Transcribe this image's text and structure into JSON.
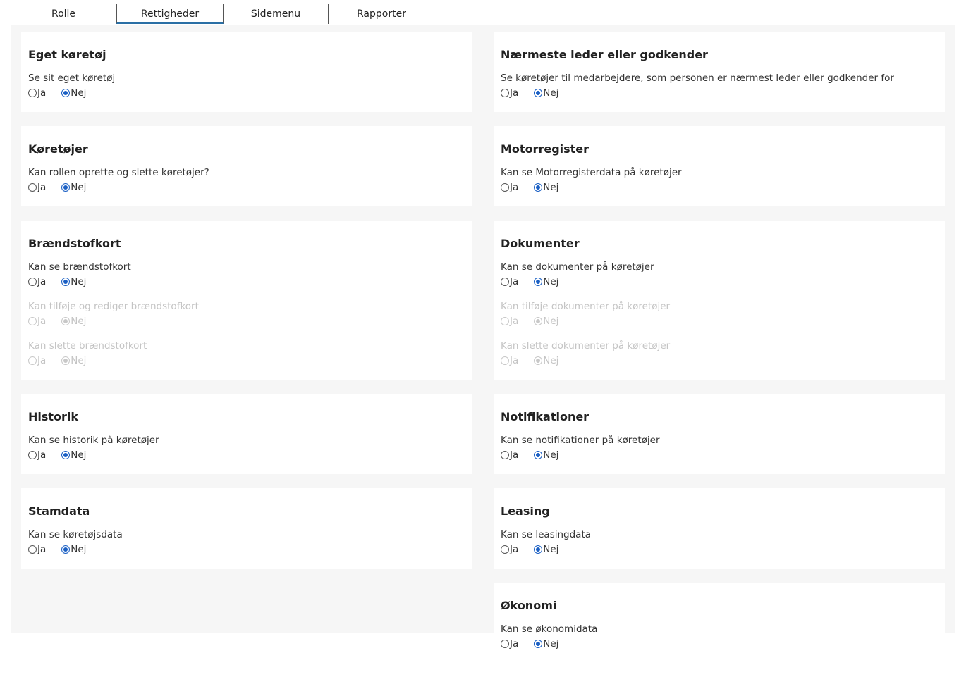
{
  "tabs": [
    {
      "label": "Rolle"
    },
    {
      "label": "Rettigheder"
    },
    {
      "label": "Sidemenu"
    },
    {
      "label": "Rapporter"
    }
  ],
  "accent_color": "#2a6fa5",
  "radio_labels": {
    "yes": "Ja",
    "no": "Nej"
  },
  "left_sections": [
    {
      "title": "Eget køretøj",
      "questions": [
        {
          "text": "Se sit eget køretøj",
          "value": "Nej",
          "disabled": false
        }
      ]
    },
    {
      "title": "Køretøjer",
      "questions": [
        {
          "text": "Kan rollen oprette og slette køretøjer?",
          "value": "Nej",
          "disabled": false
        }
      ]
    },
    {
      "title": "Brændstofkort",
      "questions": [
        {
          "text": "Kan se brændstofkort",
          "value": "Nej",
          "disabled": false
        },
        {
          "text": "Kan tilføje og rediger brændstofkort",
          "value": "Nej",
          "disabled": true
        },
        {
          "text": "Kan slette brændstofkort",
          "value": "Nej",
          "disabled": true
        }
      ]
    },
    {
      "title": "Historik",
      "questions": [
        {
          "text": "Kan se historik på køretøjer",
          "value": "Nej",
          "disabled": false
        }
      ]
    },
    {
      "title": "Stamdata",
      "questions": [
        {
          "text": "Kan se køretøjsdata",
          "value": "Nej",
          "disabled": false
        }
      ]
    }
  ],
  "right_sections": [
    {
      "title": "Nærmeste leder eller godkender",
      "questions": [
        {
          "text": "Se køretøjer til medarbejdere, som personen er nærmest leder eller godkender for",
          "value": "Nej",
          "disabled": false
        }
      ]
    },
    {
      "title": "Motorregister",
      "questions": [
        {
          "text": "Kan se Motorregisterdata på køretøjer",
          "value": "Nej",
          "disabled": false
        }
      ]
    },
    {
      "title": "Dokumenter",
      "questions": [
        {
          "text": "Kan se dokumenter på køretøjer",
          "value": "Nej",
          "disabled": false
        },
        {
          "text": "Kan tilføje dokumenter på køretøjer",
          "value": "Nej",
          "disabled": true
        },
        {
          "text": "Kan slette dokumenter på køretøjer",
          "value": "Nej",
          "disabled": true
        }
      ]
    },
    {
      "title": "Notifikationer",
      "questions": [
        {
          "text": "Kan se notifikationer på køretøjer",
          "value": "Nej",
          "disabled": false
        }
      ]
    },
    {
      "title": "Leasing",
      "questions": [
        {
          "text": "Kan se leasingdata",
          "value": "Nej",
          "disabled": false
        }
      ]
    },
    {
      "title": "Økonomi",
      "questions": [
        {
          "text": "Kan se økonomidata",
          "value": "Nej",
          "disabled": false
        }
      ]
    }
  ]
}
